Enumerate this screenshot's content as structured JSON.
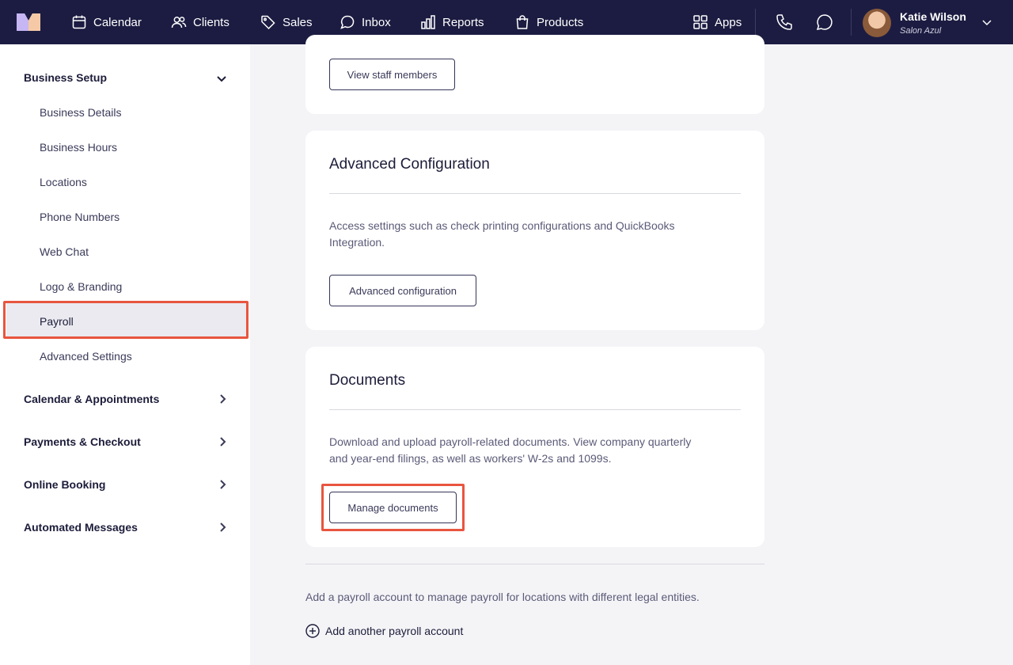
{
  "topnav": {
    "items": [
      {
        "label": "Calendar",
        "icon": "calendar-icon"
      },
      {
        "label": "Clients",
        "icon": "clients-icon"
      },
      {
        "label": "Sales",
        "icon": "tag-icon"
      },
      {
        "label": "Inbox",
        "icon": "chat-bubble-icon"
      },
      {
        "label": "Reports",
        "icon": "bar-chart-icon"
      },
      {
        "label": "Products",
        "icon": "shopping-bag-icon"
      }
    ],
    "apps_label": "Apps",
    "user": {
      "name": "Katie Wilson",
      "org": "Salon Azul"
    }
  },
  "sidebar": {
    "groups": [
      {
        "label": "Business Setup",
        "expanded": true
      },
      {
        "label": "Calendar & Appointments",
        "expanded": false
      },
      {
        "label": "Payments & Checkout",
        "expanded": false
      },
      {
        "label": "Online Booking",
        "expanded": false
      },
      {
        "label": "Automated Messages",
        "expanded": false
      }
    ],
    "items": [
      "Business Details",
      "Business Hours",
      "Locations",
      "Phone Numbers",
      "Web Chat",
      "Logo & Branding",
      "Payroll",
      "Advanced Settings"
    ],
    "active_item": "Payroll"
  },
  "main": {
    "staff_card": {
      "button": "View staff members"
    },
    "advanced_card": {
      "title": "Advanced Configuration",
      "text": "Access settings such as check printing configurations and QuickBooks Integration.",
      "button": "Advanced configuration"
    },
    "documents_card": {
      "title": "Documents",
      "text": "Download and upload payroll-related documents. View company quarterly and year-end filings, as well as workers' W-2s and 1099s.",
      "button": "Manage documents"
    },
    "footer_text": "Add a payroll account to manage payroll for locations with different legal entities.",
    "add_link": "Add another payroll account"
  },
  "colors": {
    "nav_bg": "#1c1c42",
    "highlight": "#e8553f",
    "page_bg": "#f4f4f7"
  }
}
